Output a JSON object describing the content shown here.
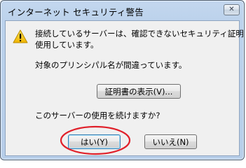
{
  "window": {
    "title": "インターネット セキュリティ警告",
    "close_symbol": "✕"
  },
  "message": {
    "line1": "接続しているサーバーは、確認できないセキュリティ証明書を",
    "line2": "使用しています。",
    "principal": "対象のプリンシパル名が間違っています。",
    "question": "このサーバーの使用を続けますか?"
  },
  "buttons": {
    "view_certificate": "証明書の表示(V)...",
    "yes": "はい(Y)",
    "no": "いいえ(N)"
  },
  "icons": {
    "warning": "warning-icon",
    "close": "close-icon"
  },
  "colors": {
    "highlight_ring": "#e0202a",
    "warning_fill": "#f5c400"
  }
}
